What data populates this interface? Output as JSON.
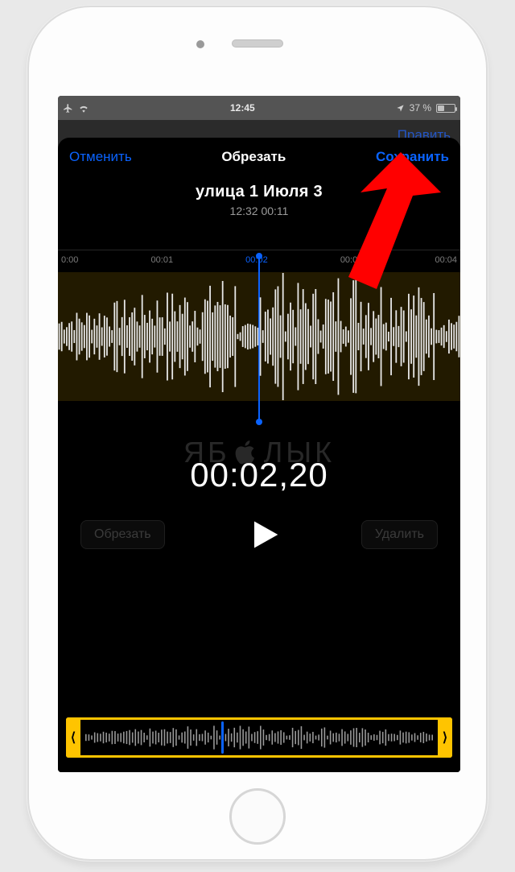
{
  "statusbar": {
    "time": "12:45",
    "battery_text": "37 %"
  },
  "under_header": {
    "edit": "Править"
  },
  "sheet": {
    "cancel": "Отменить",
    "title": "Обрезать",
    "save": "Сохранить"
  },
  "recording": {
    "name": "улица 1 Июля 3",
    "subtitle": "12:32  00:11"
  },
  "timeline": {
    "t0": "0:00",
    "t1": "00:01",
    "t2": "00:02",
    "t3": "00:03",
    "t4": "00:04"
  },
  "playback": {
    "current_time": "00:02,20",
    "trim_button": "Обрезать",
    "delete_button": "Удалить"
  },
  "watermark": {
    "left": "ЯБ",
    "right": "ЛЫК"
  },
  "trim_handles": {
    "left": "⟨",
    "right": "⟩"
  }
}
